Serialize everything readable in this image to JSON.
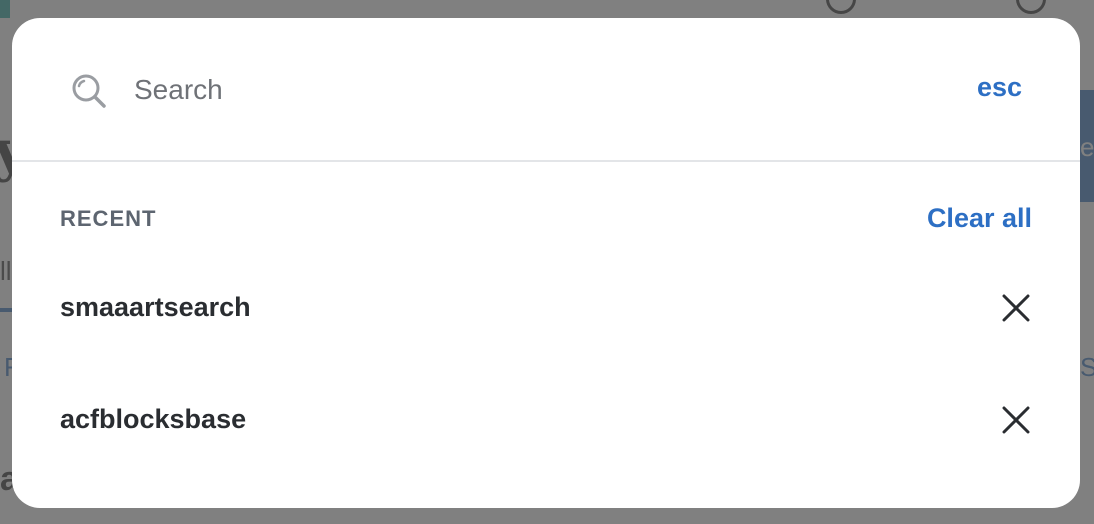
{
  "search": {
    "placeholder": "Search",
    "value": "",
    "icon": "search-icon",
    "dismiss_label": "esc"
  },
  "recent": {
    "header": "RECENT",
    "clear_all_label": "Clear all",
    "items": [
      {
        "label": "smaaartsearch",
        "remove_icon": "close-icon"
      },
      {
        "label": "acfblocksbase",
        "remove_icon": "close-icon"
      }
    ]
  },
  "colors": {
    "accent": "#2d6fc4",
    "overlay": "#545454",
    "divider": "#e3e5e8",
    "muted_text": "#5d6570",
    "primary_text": "#2a2d31"
  }
}
